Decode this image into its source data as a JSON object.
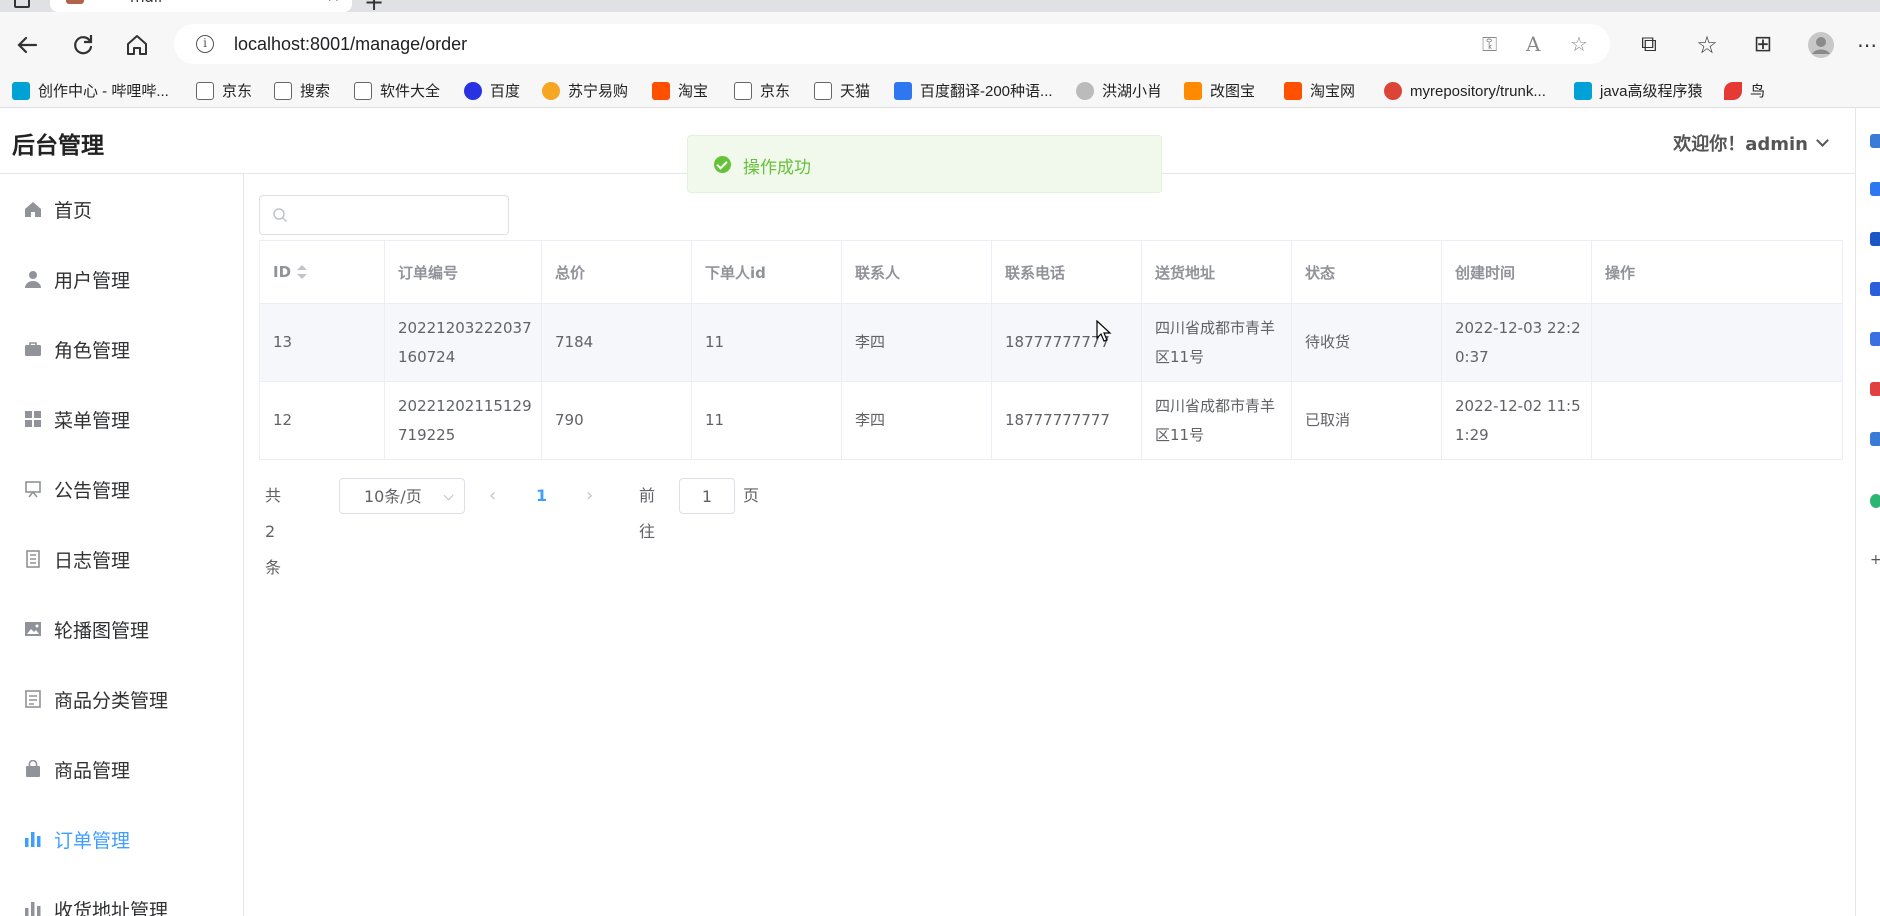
{
  "browser": {
    "tab_title": "mall",
    "url": "localhost:8001/manage/order",
    "bookmarks": [
      {
        "label": "创作中心 - 哔哩哔...",
        "color": "#00a1d6"
      },
      {
        "label": "京东",
        "color": "#888888"
      },
      {
        "label": "搜索",
        "color": "#888888"
      },
      {
        "label": "软件大全",
        "color": "#888888"
      },
      {
        "label": "百度",
        "color": "#2932e1"
      },
      {
        "label": "苏宁易购",
        "color": "#f5a623"
      },
      {
        "label": "淘宝",
        "color": "#ff5000"
      },
      {
        "label": "京东",
        "color": "#888888"
      },
      {
        "label": "天猫",
        "color": "#888888"
      },
      {
        "label": "百度翻译-200种语...",
        "color": "#2e77f0"
      },
      {
        "label": "洪湖小肖",
        "color": "#999999"
      },
      {
        "label": "改图宝",
        "color": "#ff8a00"
      },
      {
        "label": "淘宝网",
        "color": "#ff5000"
      },
      {
        "label": "myrepository/trunk...",
        "color": "#db4437"
      },
      {
        "label": "java高级程序猿",
        "color": "#00a1d6"
      },
      {
        "label": "鸟",
        "color": "#e53935"
      }
    ]
  },
  "app": {
    "title": "后台管理",
    "welcome": "欢迎你！admin",
    "sidebar": [
      {
        "label": "首页",
        "icon": "home-icon",
        "active": false
      },
      {
        "label": "用户管理",
        "icon": "user-icon",
        "active": false
      },
      {
        "label": "角色管理",
        "icon": "briefcase-icon",
        "active": false
      },
      {
        "label": "菜单管理",
        "icon": "grid-icon",
        "active": false
      },
      {
        "label": "公告管理",
        "icon": "notice-board-icon",
        "active": false
      },
      {
        "label": "日志管理",
        "icon": "log-icon",
        "active": false
      },
      {
        "label": "轮播图管理",
        "icon": "image-icon",
        "active": false
      },
      {
        "label": "商品分类管理",
        "icon": "category-icon",
        "active": false
      },
      {
        "label": "商品管理",
        "icon": "shopping-bag-icon",
        "active": false
      },
      {
        "label": "订单管理",
        "icon": "bar-chart-icon",
        "active": true
      },
      {
        "label": "收货地址管理",
        "icon": "address-icon",
        "active": false
      }
    ],
    "search": {
      "placeholder": ""
    },
    "table": {
      "columns": [
        "ID",
        "订单编号",
        "总价",
        "下单人id",
        "联系人",
        "联系电话",
        "送货地址",
        "状态",
        "创建时间",
        "操作"
      ],
      "rows": [
        [
          "13",
          "20221203222037160724",
          "7184",
          "11",
          "李四",
          "18777777777",
          "四川省成都市青羊区11号",
          "待收货",
          "2022-12-03 22:20:37",
          ""
        ],
        [
          "12",
          "20221202115129719225",
          "790",
          "11",
          "李四",
          "18777777777",
          "四川省成都市青羊区11号",
          "已取消",
          "2022-12-02 11:51:29",
          ""
        ]
      ]
    },
    "pagination": {
      "total": "共 2 条",
      "page_size": "10条/页",
      "current_page": "1",
      "goto_label": "前往",
      "goto_value": "1",
      "page_suffix": "页"
    },
    "toast": {
      "message": "操作成功",
      "type": "success"
    }
  }
}
